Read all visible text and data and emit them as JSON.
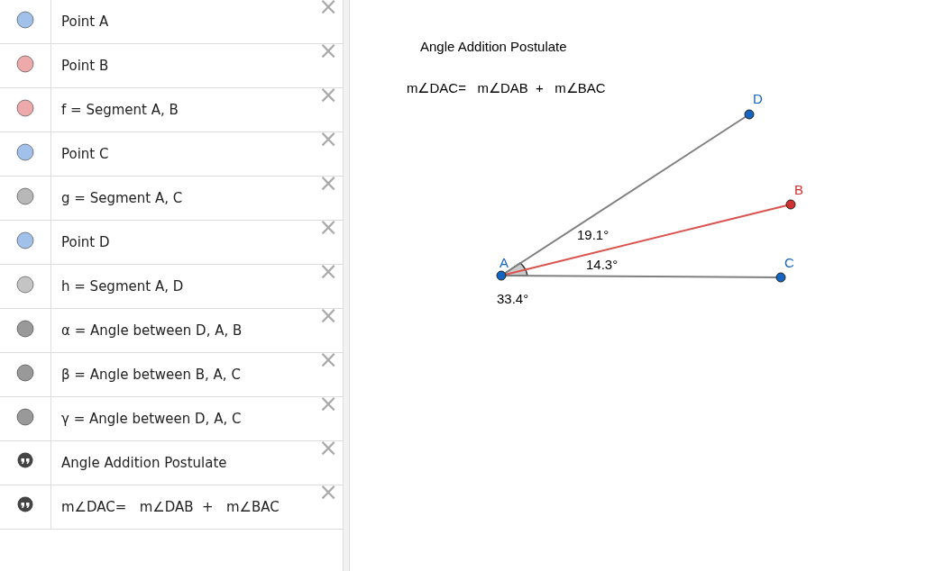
{
  "algebra_view": {
    "items": [
      {
        "kind": "marble",
        "color": "#a1c1ea",
        "text": "Point A"
      },
      {
        "kind": "marble",
        "color": "#ecaaaa",
        "text": "Point B"
      },
      {
        "kind": "marble",
        "color": "#ecaaaa",
        "text": "f = Segment A, B"
      },
      {
        "kind": "marble",
        "color": "#a1c1ea",
        "text": "Point C"
      },
      {
        "kind": "marble",
        "color": "#b8b8b8",
        "text": "g = Segment A, C"
      },
      {
        "kind": "marble",
        "color": "#a1c1ea",
        "text": "Point D"
      },
      {
        "kind": "marble",
        "color": "#c4c4c4",
        "text": "h = Segment A, D"
      },
      {
        "kind": "marble",
        "color": "#999999",
        "text": "α = Angle between D, A, B"
      },
      {
        "kind": "marble",
        "color": "#999999",
        "text": "β = Angle between B, A, C"
      },
      {
        "kind": "marble",
        "color": "#999999",
        "text": "γ = Angle between D, A, C"
      },
      {
        "kind": "text",
        "color": "#444444",
        "text": "Angle Addition Postulate"
      },
      {
        "kind": "text",
        "color": "#444444",
        "text": "m∠DAC=   m∠DAB  +   m∠BAC"
      }
    ],
    "close_glyph": "×"
  },
  "graphics_view": {
    "title": "Angle Addition Postulate",
    "equation": "m∠DAC=   m∠DAB  +   m∠BAC",
    "points": [
      {
        "label": "A",
        "color": "#1565c0"
      },
      {
        "label": "D",
        "color": "#1565c0"
      },
      {
        "label": "B",
        "color": "#d32f2f"
      },
      {
        "label": "C",
        "color": "#1565c0"
      }
    ],
    "angle_labels": [
      "19.1°",
      "14.3°",
      "33.4°"
    ]
  }
}
